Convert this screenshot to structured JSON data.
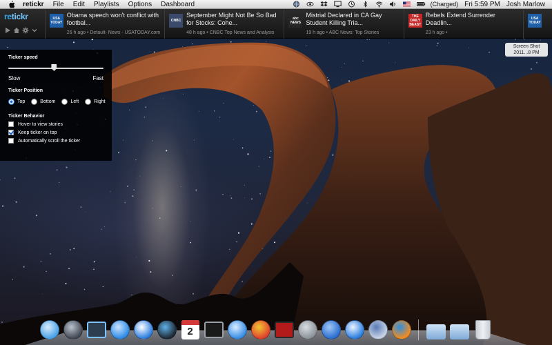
{
  "menubar": {
    "app_name": "retickr",
    "menus": [
      "File",
      "Edit",
      "Playlists",
      "Options",
      "Dashboard"
    ],
    "battery_text": "(Charged)",
    "clock": "Fri 5:59 PM",
    "user": "Josh Marlow"
  },
  "ticker": {
    "logo_re": "re",
    "logo_tickr": "tickr",
    "stories": [
      {
        "source_badge": "USA TODAY",
        "badge_color": "#1f5fa8",
        "headline": "Obama speech won't conflict with footbal...",
        "meta": "26 h ago • Default- News - USATODAY.com"
      },
      {
        "source_badge": "CNBC",
        "badge_color": "#3b4a6b",
        "headline": "September Might Not Be So Bad for Stocks: Cohe...",
        "meta": "48 h ago • CNBC Top News and Analysis"
      },
      {
        "source_badge": "abc NEWS",
        "badge_color": "#262626",
        "headline": "Mistrial Declared in CA Gay Student Killing Tria...",
        "meta": "19 h ago • ABC News: Top Stories"
      },
      {
        "source_badge": "THE DAILY BEAST",
        "badge_color": "#c62828",
        "headline": "Rebels Extend Surrender Deadlin...",
        "meta": "23 h ago •"
      },
      {
        "source_badge": "USA TODAY",
        "badge_color": "#1f5fa8",
        "headline": "",
        "meta": ""
      }
    ]
  },
  "settings": {
    "speed_title": "Ticker speed",
    "speed_value": 0.48,
    "slow_label": "Slow",
    "fast_label": "Fast",
    "position_title": "Ticker Position",
    "positions": [
      {
        "label": "Top",
        "selected": true
      },
      {
        "label": "Bottom",
        "selected": false
      },
      {
        "label": "Left",
        "selected": false
      },
      {
        "label": "Right",
        "selected": false
      }
    ],
    "behavior_title": "Ticker Behavior",
    "behaviors": [
      {
        "label": "Hover to view stories",
        "checked": false
      },
      {
        "label": "Keep ticker on top",
        "checked": true
      },
      {
        "label": "Automatically scroll the ticker",
        "checked": false
      }
    ]
  },
  "desktop": {
    "file_label_line1": "Screen Shot",
    "file_label_line2": "2011...8 PM"
  },
  "dock": {
    "apps": [
      "finder-icon",
      "launchpad-icon",
      "dashboard-icon",
      "app-store-icon",
      "ichat-icon",
      "facetime-icon",
      "ical-icon",
      "terminal-icon",
      "itunes-icon",
      "chrome-icon",
      "photo-booth-icon",
      "system-preferences-icon",
      "xcode-icon",
      "safari-icon",
      "preview-icon",
      "retickr-app-icon",
      "applications-folder-icon",
      "documents-folder-icon",
      "trash-icon"
    ],
    "ical_day": "2"
  }
}
